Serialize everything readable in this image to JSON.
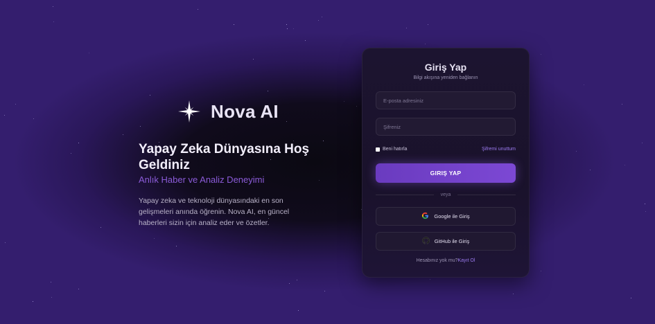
{
  "brand": {
    "name": "Nova AI",
    "logo_icon": "sparkle-star-icon"
  },
  "hero": {
    "headline": "Yapay Zeka Dünyasına Hoş Geldiniz",
    "subheadline": "Anlık Haber ve Analiz Deneyimi",
    "description": "Yapay zeka ve teknoloji dünyasındaki en son gelişmeleri anında öğrenin. Nova AI, en güncel haberleri sizin için analiz eder ve özetler."
  },
  "login": {
    "title": "Giriş Yap",
    "subtitle": "Bilgi akışına yeniden bağlanın",
    "email_placeholder": "E-posta adresiniz",
    "password_placeholder": "Şifreniz",
    "remember_label": "Beni hatırla",
    "forgot_label": "Şifremi unuttum",
    "submit_label": "GIRIŞ YAP",
    "divider_text": "veya",
    "google_label": "Google ile Giriş",
    "google_icon": "google-icon",
    "github_label": "GitHub ile Giriş",
    "github_icon": "github-icon",
    "signup_question": "Hesabınız yok mu?",
    "signup_link": "Kayıt Ol"
  },
  "colors": {
    "accent": "#7c48d4",
    "link": "#9c7bf0",
    "subheadline": "#8b5bd8"
  }
}
